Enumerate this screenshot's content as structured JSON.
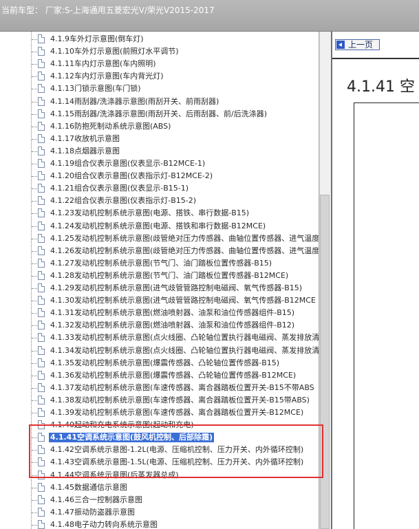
{
  "window": {
    "title": "当前车型：  厂家:S-上海通用五菱宏光V/荣光V2015-2017"
  },
  "tree": {
    "items": [
      "4.1.9车外灯示意图(倒车灯)",
      "4.1.10车外灯示意图(前照灯水平调节)",
      "4.1.11车内灯示意图(车内照明)",
      "4.1.12车内灯示意图(车内背光灯)",
      "4.1.13门锁示意图(车门锁)",
      "4.1.14雨刮器/洗涤器示意图(雨刮开关、前雨刮器)",
      "4.1.15雨刮器/洗涤器示意图(雨刮开关、后雨刮器、前/后洗涤器)",
      "4.1.16防抱死制动系统示意图(ABS)",
      "4.1.17收放机示意图",
      "4.1.18点烟器示意图",
      "4.1.19组合仪表示意图(仪表显示-B12MCE-1)",
      "4.1.20组合仪表示意图(仪表指示灯-B12MCE-2)",
      "4.1.21组合仪表示意图(仪表显示-B15-1)",
      "4.1.22组合仪表示意图(仪表指示灯-B15-2)",
      "4.1.23发动机控制系统示意图(电源、搭铁、串行数据-B15)",
      "4.1.24发动机控制系统示意图(电源、搭铁和串行数据-B12MCE)",
      "4.1.25发动机控制系统示意图(歧管绝对压力传感器、曲轴位置传感器、进气温度",
      "4.1.26发动机控制系统示意图(歧管绝对压力传感器、曲轴位置传感器、进气温度",
      "4.1.27发动机控制系统示意图(节气门、油门踏板位置传感器-B15)",
      "4.1.28发动机控制系统示意图(节气门、油门踏板位置传感器-B12MCE)",
      "4.1.29发动机控制系统示意图(进气歧管管路控制电磁阀、氧气传感器-B15)",
      "4.1.30发动机控制系统示意图(进气歧管管路控制电磁阀、氧气传感器-B12MCE",
      "4.1.31发动机控制系统示意图(燃油喷射器、油泵和油位传感器组件-B15)",
      "4.1.32发动机控制系统示意图(燃油喷射器、油泵和油位传感器组件-B12)",
      "4.1.33发动机控制系统示意图(点火线圈、凸轮轴位置执行器电磁阀、蒸发排放清",
      "4.1.34发动机控制系统示意图(点火线圈、凸轮轴位置执行器电磁阀、蒸发排放清",
      "4.1.35发动机控制系统示意图(爆震传感器、凸轮轴位置传感器-B15)",
      "4.1.36发动机控制系统示意图(爆震传感器、凸轮轴位置传感器-B12MCE)",
      "4.1.37发动机控制系统示意图(车速传感器、离合器踏板位置开关-B15不带ABS",
      "4.1.38发动机控制系统示意图(车速传感器、离合器踏板位置开关-B15带ABS)",
      "4.1.39发动机控制系统示意图(车速传感器、离合器踏板位置开关-B12MCE)",
      "4.1.40起动和充电系统示意图(起动和充电)",
      "4.1.41空调系统示意图(鼓风机控制、后部除霜)",
      "4.1.42空调系统示意图-1.2L(电源、压缩机控制、压力开关、内外循环控制)",
      "4.1.43空调系统示意图-1.5L(电源、压缩机控制、压力开关、内外循环控制)",
      "4.1.44空调系统示意图(后蒸发器总成)",
      "4.1.45数据通信示意图",
      "4.1.46三合一控制器示意图",
      "4.1.47振动防盗器示意图",
      "4.1.48电子动力转向系统示意图"
    ],
    "selected_index": 32
  },
  "content": {
    "prev_button_label": "上一页",
    "heading": "4.1.41 空"
  },
  "colors": {
    "highlight_border": "#e03030",
    "selection_bg": "#3b6fd6"
  }
}
